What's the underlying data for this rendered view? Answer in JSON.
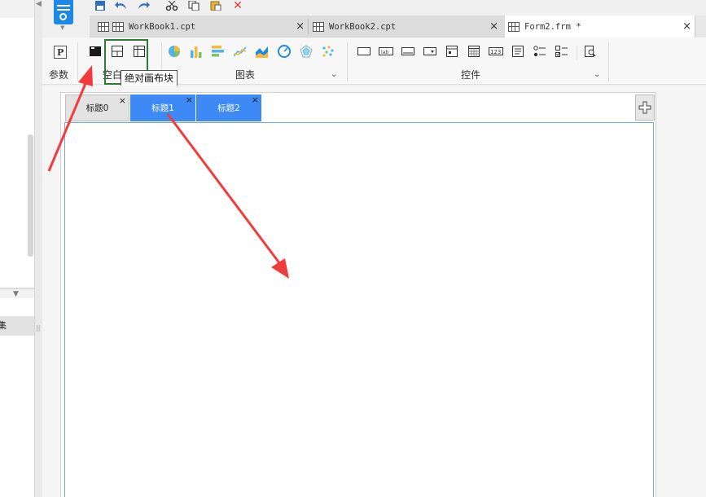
{
  "document_tabs": [
    {
      "name": "WorkBook1.cpt",
      "close": "×"
    },
    {
      "name": "WorkBook2.cpt",
      "close": "×"
    },
    {
      "name": "Form2.frm *",
      "close": "×"
    }
  ],
  "ribbon": {
    "params_label": "参数",
    "blank_label": "空白",
    "chart_label": "图表",
    "control_label": "控件",
    "chart_icons": [
      "pie-chart-icon",
      "bar-chart-icon",
      "horizontal-bar-icon",
      "line-chart-icon",
      "area-chart-icon",
      "gauge-chart-icon",
      "radar-chart-icon",
      "scatter-chart-icon"
    ],
    "control_icons": [
      "textbox-icon",
      "label-icon",
      "button-icon",
      "combobox-icon",
      "date-icon",
      "calendar-icon",
      "number-icon",
      "textarea-icon",
      "radio-icon",
      "checkbox-icon",
      "preview-icon"
    ]
  },
  "tooltip": {
    "text": "绝对画布块"
  },
  "form_tabs": [
    {
      "label": "标题0",
      "close": "×"
    },
    {
      "label": "标题1",
      "close": "×"
    },
    {
      "label": "标题2",
      "close": "×"
    }
  ],
  "left_panel": {
    "item_text": "集"
  },
  "colors": {
    "accent": "#1e88e5",
    "active_tab": "#3d8af7",
    "highlight_box": "#2e7d32",
    "arrow": "#f23c3c"
  }
}
